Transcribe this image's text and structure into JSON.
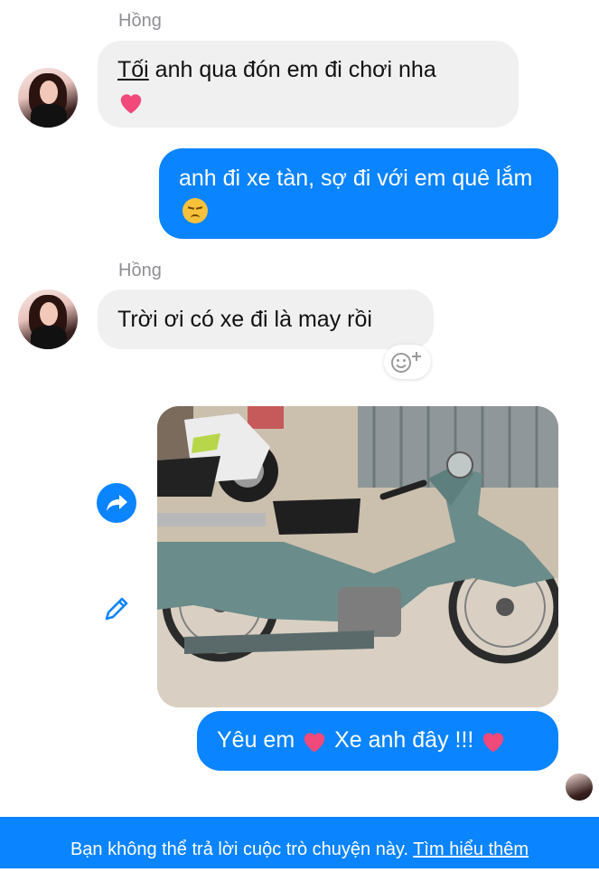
{
  "messages": [
    {
      "sender": "Hồng",
      "text_prefix": "Tối",
      "text_rest": " anh qua đón em đi chơi nha",
      "emoji": "red-heart"
    },
    {
      "sender": "me",
      "text": "anh đi xe tàn, sợ đi với em quê lắm",
      "emoji": "disappointed-face"
    },
    {
      "sender": "Hồng",
      "text": "Trời ơi có xe đi là may rồi"
    },
    {
      "sender": "me",
      "type": "photo",
      "alt": "old motorbike"
    },
    {
      "sender": "me",
      "text_a": "Yêu em",
      "text_b": "Xe anh đây !!!",
      "emoji": "pink-heart"
    }
  ],
  "icons": {
    "share": "share-icon",
    "edit": "pencil-icon",
    "react": "add-reaction-icon"
  },
  "footer": {
    "text": "Bạn không thể trả lời cuộc trò chuyện này.",
    "link": "Tìm hiểu thêm"
  },
  "colors": {
    "accent": "#0a84ff",
    "incoming_bubble": "#f0f0f0",
    "heart": "#f0497a"
  }
}
